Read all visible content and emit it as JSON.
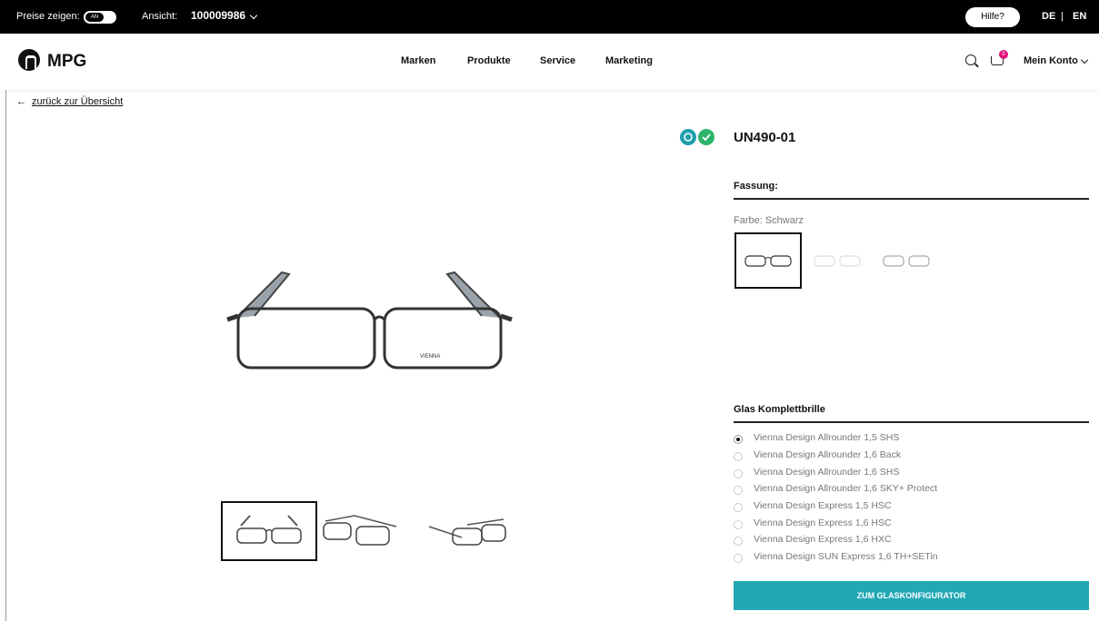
{
  "topbar": {
    "price_label": "Preise zeigen:",
    "price_toggle": "AN",
    "view_label": "Ansicht:",
    "account_number": "100009986",
    "help": "Hilfe?",
    "lang_de": "DE",
    "lang_sep": "|",
    "lang_en": "EN"
  },
  "nav": {
    "logo": "MPG",
    "items": [
      "Marken",
      "Produkte",
      "Service",
      "Marketing"
    ],
    "cart_count": "0",
    "account": "Mein Konto"
  },
  "back_link": "zurück zur Übersicht",
  "product": {
    "title": "UN490-01",
    "frame_heading": "Fassung:",
    "color_label": "Farbe: Schwarz",
    "glass_heading": "Glas Komplettbrille",
    "glass_options": [
      "Vienna Design Allrounder 1,5 SHS",
      "Vienna Design Allrounder 1,6 Back",
      "Vienna Design Allrounder 1,6 SHS",
      "Vienna Design Allrounder 1,6 SKY+ Protect",
      "Vienna Design Express 1,5 HSC",
      "Vienna Design Express 1,6 HSC",
      "Vienna Design Express 1,6 HXC",
      "Vienna Design SUN Express 1,6 TH+SETin"
    ],
    "selected_glass_index": 0,
    "cta": "ZUM GLASKONFIGURATOR",
    "brand_on_frame": "VIENNA"
  },
  "colors": {
    "accent": "#22a8b5",
    "badge": "#e5127c",
    "teal_icon": "#1e9fae",
    "green_icon": "#2db36b"
  }
}
